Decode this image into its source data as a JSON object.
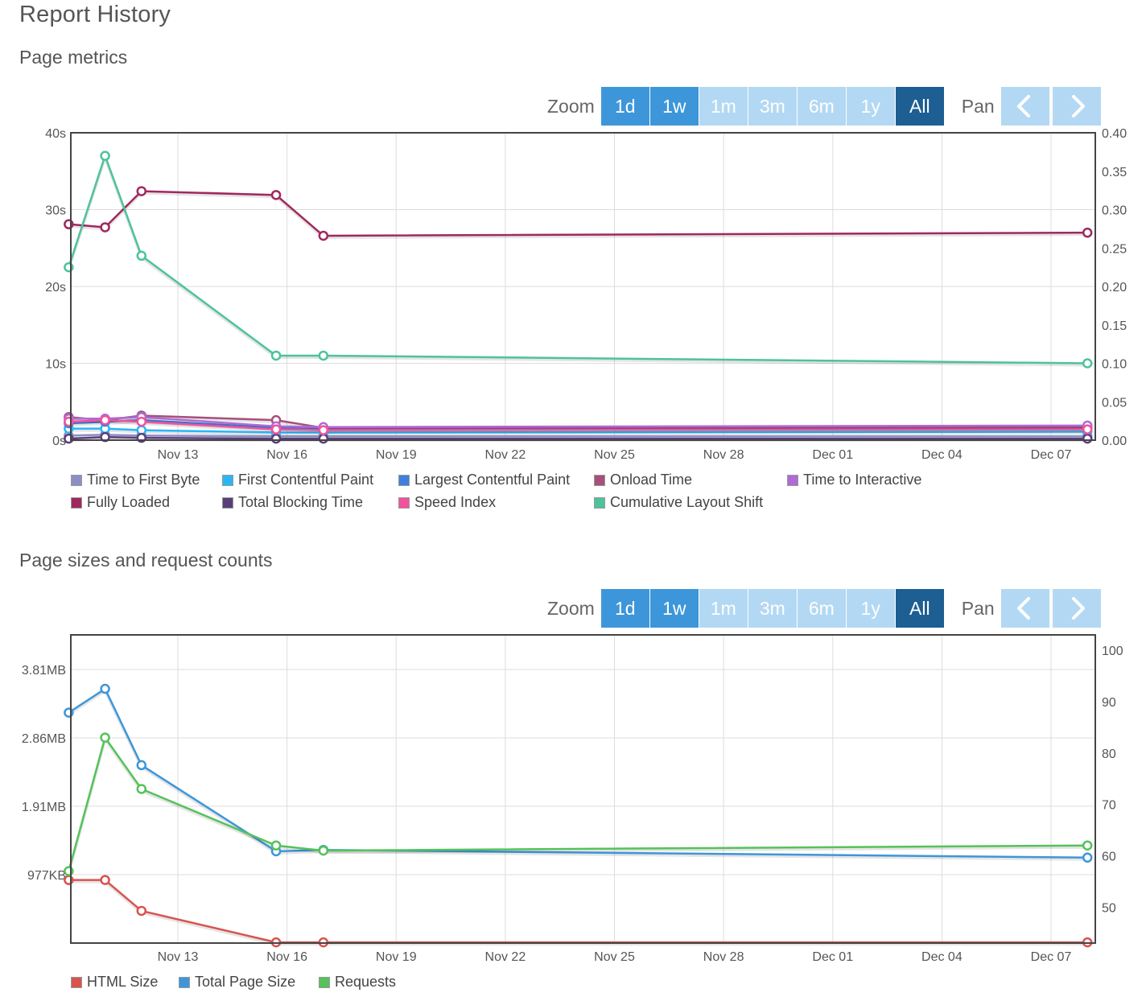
{
  "page_title": "Report History",
  "zoom": {
    "zoom_label": "Zoom",
    "pan_label": "Pan",
    "buttons": [
      "1d",
      "1w",
      "1m",
      "3m",
      "6m",
      "1y",
      "All"
    ],
    "button_states": [
      "active",
      "active",
      "inactive",
      "inactive",
      "inactive",
      "inactive",
      "selected"
    ]
  },
  "colors": {
    "active": "#3d96d9",
    "inactive": "#b3d8f3",
    "selected": "#1d5e93"
  },
  "chart_data": [
    {
      "type": "line",
      "title": "Page metrics",
      "x_ticks": [
        "Nov 13",
        "Nov 16",
        "Nov 19",
        "Nov 22",
        "Nov 25",
        "Nov 28",
        "Dec 01",
        "Dec 04",
        "Dec 07"
      ],
      "x": [
        "Nov 10",
        "Nov 11",
        "Nov 12",
        "Nov 15.7",
        "Nov 17",
        "Dec 08"
      ],
      "y_left": {
        "ticks": [
          "0s",
          "10s",
          "20s",
          "30s",
          "40s"
        ],
        "range": [
          0,
          40
        ],
        "unit": "s"
      },
      "y_right": {
        "ticks": [
          "0.00",
          "0.05",
          "0.10",
          "0.15",
          "0.20",
          "0.25",
          "0.30",
          "0.35",
          "0.40"
        ],
        "range": [
          0,
          0.4
        ]
      },
      "series": [
        {
          "name": "Time to First Byte",
          "color": "#8e8ec6",
          "axis": "left",
          "values": [
            0.6,
            0.7,
            0.6,
            0.5,
            0.5,
            0.5
          ]
        },
        {
          "name": "First Contentful Paint",
          "color": "#29b6f6",
          "axis": "left",
          "values": [
            1.5,
            1.5,
            1.3,
            1.0,
            1.0,
            1.1
          ]
        },
        {
          "name": "Largest Contentful Paint",
          "color": "#3f7fe0",
          "axis": "left",
          "values": [
            2.2,
            2.4,
            2.6,
            1.6,
            1.5,
            1.6
          ]
        },
        {
          "name": "Onload Time",
          "color": "#a6507a",
          "axis": "left",
          "values": [
            3.0,
            2.6,
            3.2,
            2.6,
            1.6,
            1.7
          ]
        },
        {
          "name": "Time to Interactive",
          "color": "#b06ad6",
          "axis": "left",
          "values": [
            2.8,
            2.8,
            3.0,
            1.8,
            1.7,
            1.9
          ]
        },
        {
          "name": "Fully Loaded",
          "color": "#a0285e",
          "axis": "left",
          "values": [
            28.1,
            27.7,
            32.4,
            31.9,
            26.6,
            27.0
          ]
        },
        {
          "name": "Total Blocking Time",
          "color": "#5a3e7a",
          "axis": "left",
          "values": [
            0.2,
            0.4,
            0.3,
            0.2,
            0.2,
            0.2
          ]
        },
        {
          "name": "Speed Index",
          "color": "#f2529c",
          "axis": "left",
          "values": [
            2.4,
            2.6,
            2.4,
            1.4,
            1.3,
            1.4
          ]
        },
        {
          "name": "Cumulative Layout Shift",
          "color": "#4cc39c",
          "axis": "right",
          "values": [
            0.225,
            0.37,
            0.24,
            0.11,
            0.11,
            0.1
          ]
        }
      ],
      "legend": "bottom"
    },
    {
      "type": "line",
      "title": "Page sizes and request counts",
      "x_ticks": [
        "Nov 13",
        "Nov 16",
        "Nov 19",
        "Nov 22",
        "Nov 25",
        "Nov 28",
        "Dec 01",
        "Dec 04",
        "Dec 07"
      ],
      "x": [
        "Nov 10",
        "Nov 11",
        "Nov 12",
        "Nov 15.7",
        "Nov 17",
        "Dec 08"
      ],
      "y_left": {
        "ticks": [
          "977KB",
          "1.91MB",
          "2.86MB",
          "3.81MB"
        ],
        "tick_values_kb": [
          977,
          1954,
          2929,
          3906
        ],
        "range_kb": [
          0,
          4400
        ]
      },
      "y_right": {
        "ticks": [
          "50",
          "60",
          "70",
          "80",
          "90",
          "100"
        ],
        "range": [
          43,
          103
        ]
      },
      "series": [
        {
          "name": "HTML Size",
          "color": "#d9534f",
          "axis": "left",
          "values_kb": [
            900,
            900,
            460,
            10,
            10,
            10
          ]
        },
        {
          "name": "Total Page Size",
          "color": "#3d96d9",
          "axis": "left",
          "values_kb": [
            3290,
            3630,
            2540,
            1310,
            1330,
            1220
          ]
        },
        {
          "name": "Requests",
          "color": "#55c25a",
          "axis": "right",
          "values": [
            57,
            83,
            73,
            62,
            61,
            62
          ]
        }
      ],
      "legend": "bottom"
    }
  ]
}
